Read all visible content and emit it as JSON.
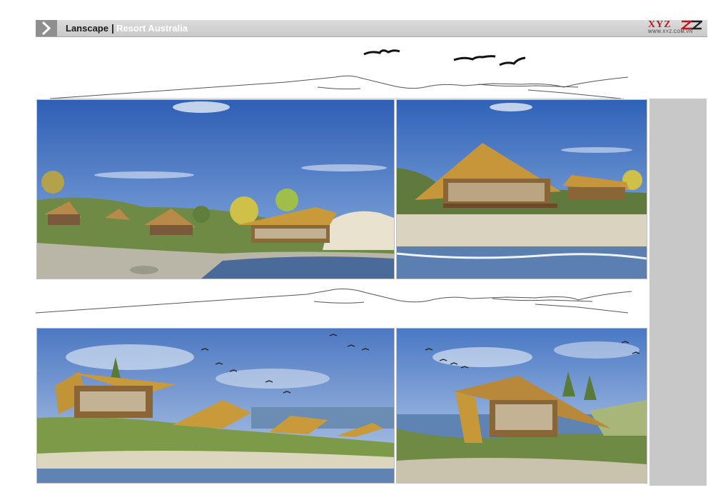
{
  "header": {
    "project": "Lanscape",
    "separator": "|",
    "subtitle": "Resort Australia"
  },
  "logo": {
    "main": "XYZ",
    "url": "WWW.XYZ.COM.VN"
  },
  "colors": {
    "header_bg": "#cfcfcf",
    "logo_red": "#c0181f",
    "sidebar": "#c8c8c8",
    "sky": "#3f6fc0",
    "roof": "#c99a3a"
  }
}
